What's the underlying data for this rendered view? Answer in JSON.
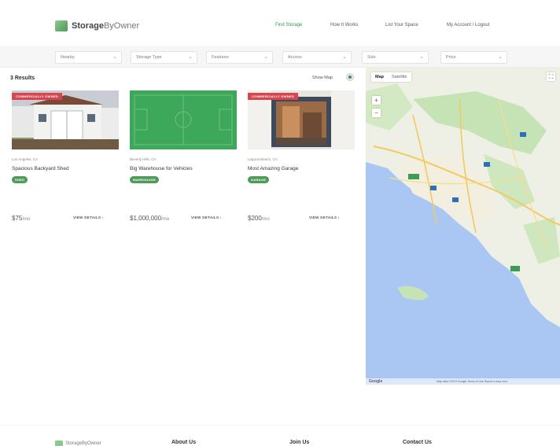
{
  "header": {
    "logo": {
      "brand": "Storage",
      "brand_suffix": "ByOwner"
    },
    "nav": [
      {
        "label": "Find Storage",
        "active": true
      },
      {
        "label": "How It Works",
        "active": false
      },
      {
        "label": "List Your Space",
        "active": false
      },
      {
        "label": "My Account / Logout",
        "active": false
      }
    ]
  },
  "filters": [
    {
      "label": "Nearby"
    },
    {
      "label": "Storage Type"
    },
    {
      "label": "Features"
    },
    {
      "label": "Access"
    },
    {
      "label": "Size"
    },
    {
      "label": "Price"
    }
  ],
  "results": {
    "count_label": "3 Results",
    "show_map_label": "Show Map"
  },
  "listings": [
    {
      "ribbon": "COMMERCIALLY OWNED",
      "location": "Los Angeles, CA",
      "title": "Spacious Backyard Shed",
      "badge": "SHED",
      "price": "$75",
      "price_unit": "/mo",
      "details_label": "VIEW DETAILS"
    },
    {
      "ribbon": "",
      "location": "Beverly Hills, CA",
      "title": "Big Warehouse for Vehicles",
      "badge": "WAREHOUSE",
      "price": "$1,000,000",
      "price_unit": "/mo",
      "details_label": "VIEW DETAILS"
    },
    {
      "ribbon": "COMMERCIALLY OWNED",
      "location": "Laguna Beach, CA",
      "title": "Most Amazing Garage",
      "badge": "GARAGE",
      "price": "$200",
      "price_unit": "/mo",
      "details_label": "VIEW DETAILS"
    }
  ],
  "map": {
    "tabs": [
      {
        "label": "Map",
        "active": true
      },
      {
        "label": "Satellite",
        "active": false
      }
    ],
    "zoom_in": "+",
    "zoom_out": "−",
    "fullscreen": "⛶",
    "google_label": "Google",
    "attribution": "Map data ©2019 Google   Terms of Use   Report a map error"
  },
  "footer": {
    "logo": {
      "brand": "Storage",
      "brand_suffix": "ByOwner"
    },
    "columns": [
      "About Us",
      "Join Us",
      "Contact Us"
    ]
  },
  "colors": {
    "accent": "#2e9a52",
    "badge": "#4f9a5a",
    "ribbon": "#d64550",
    "water": "#aac7f4",
    "land": "#eef0e6",
    "park": "#c6e3b5"
  }
}
